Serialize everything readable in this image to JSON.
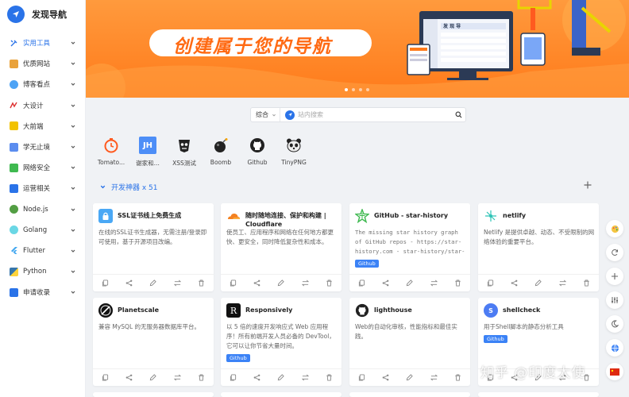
{
  "app": {
    "title": "发现导航"
  },
  "sidebar": {
    "items": [
      {
        "label": "实用工具",
        "icon": "tools-icon"
      },
      {
        "label": "优质网站",
        "icon": "website-icon"
      },
      {
        "label": "博客看点",
        "icon": "blog-icon"
      },
      {
        "label": "大设计",
        "icon": "design-icon"
      },
      {
        "label": "大前端",
        "icon": "frontend-icon"
      },
      {
        "label": "学无止境",
        "icon": "book-icon"
      },
      {
        "label": "网络安全",
        "icon": "security-icon"
      },
      {
        "label": "运营相关",
        "icon": "operations-icon"
      },
      {
        "label": "Node.js",
        "icon": "nodejs-icon"
      },
      {
        "label": "Golang",
        "icon": "golang-icon"
      },
      {
        "label": "Flutter",
        "icon": "flutter-icon"
      },
      {
        "label": "Python",
        "icon": "python-icon"
      },
      {
        "label": "申请收录",
        "icon": "apply-icon"
      }
    ]
  },
  "banner": {
    "slogan": "创建属于您的导航",
    "mockup_title": "发 现 导"
  },
  "search": {
    "category": "综合",
    "placeholder": "站内搜索"
  },
  "quick_links": [
    {
      "label": "Tomato...",
      "icon": "tomato-icon"
    },
    {
      "label": "谢家和...",
      "icon": "jh-icon",
      "text": "JH"
    },
    {
      "label": "XSS测试",
      "icon": "xss-icon"
    },
    {
      "label": "Boomb",
      "icon": "bomb-icon"
    },
    {
      "label": "Github",
      "icon": "github-icon"
    },
    {
      "label": "TinyPNG",
      "icon": "panda-icon"
    }
  ],
  "section": {
    "title": "开发神器 x 51"
  },
  "cards": [
    {
      "title": "SSL证书线上免费生成",
      "desc": "在线的SSL证书生成器，无需注册/登录即可使用，基于开源项目改编。",
      "icon": "lock-icon"
    },
    {
      "title": "随时随地连接、保护和构建 | Cloudflare",
      "desc": "使员工、应用程序和网络在任何地方都更快、更安全，同时降低复杂性和成本。",
      "icon": "cloudflare-icon"
    },
    {
      "title": "GitHub - star-history",
      "desc": "The missing star history graph of GitHub repos - https://star-history.com - star-history/star-history",
      "tag": "Github",
      "icon": "star-icon"
    },
    {
      "title": "netlify",
      "desc": "Netlify 是提供卓越、动态、不受限制的网络体验的重要平台。",
      "icon": "netlify-icon"
    },
    {
      "title": "Planetscale",
      "desc": "兼容 MySQL 的无服务器数据库平台。",
      "icon": "planetscale-icon"
    },
    {
      "title": "Responsively",
      "desc": "以 5 倍的速度开发响应式 Web 应用程序！所有前端开发人员必备的 DevTool，它可以让你节省大量时间。",
      "tag": "Github",
      "icon": "responsively-icon",
      "text": "R"
    },
    {
      "title": "lighthouse",
      "desc": "Web的自动化审核，性能指标和最佳实践。",
      "icon": "lighthouse-icon"
    },
    {
      "title": "shellcheck",
      "desc": "用于Shell脚本的静态分析工具",
      "tag": "Github",
      "icon": "shellcheck-icon",
      "text": "S"
    }
  ],
  "watermark": "知乎 @印度太使",
  "colors": {
    "accent": "#2a73e8",
    "banner": "#ff8a2a",
    "tag": "#3b82f6"
  }
}
